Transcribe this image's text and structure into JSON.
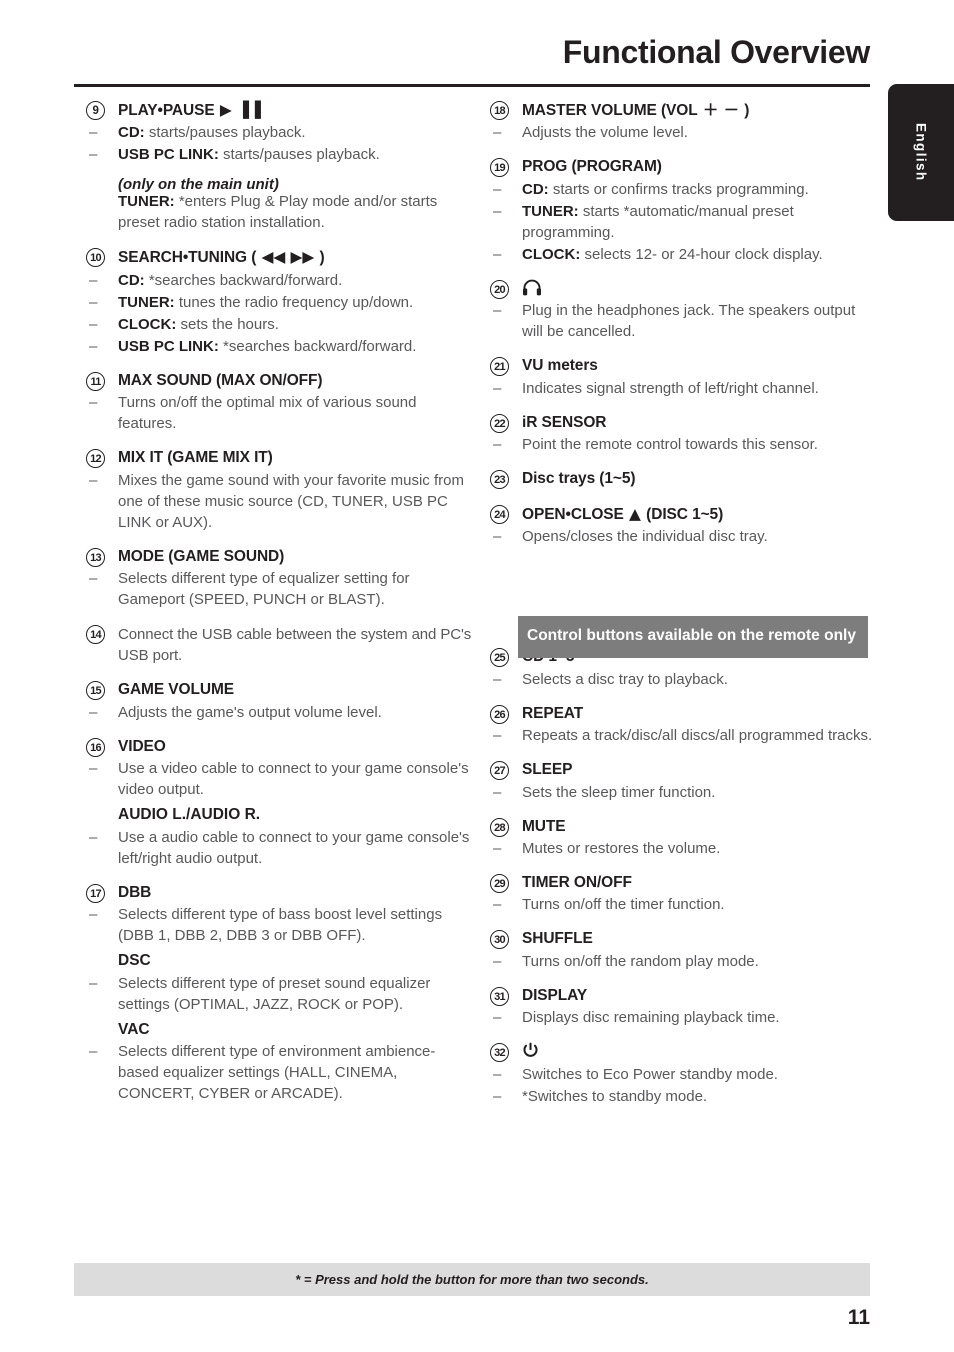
{
  "header": {
    "title": "Functional Overview"
  },
  "language_tab": {
    "label": "English"
  },
  "footer": {
    "note": "* = Press and hold the button for more than two seconds.",
    "page_number": "11"
  },
  "remote_banner": {
    "label": "Control buttons available on the remote only"
  },
  "glyphs": {
    "play": "▶",
    "pause": "▐▐",
    "rewind": "◀◀",
    "forward": "▶▶",
    "eject": "▲",
    "plus": "＋",
    "minus": "－",
    "headphones": "Ω",
    "power": "⏻",
    "dash": "–",
    "bullet_dot": "•"
  },
  "left_column": [
    {
      "number": "9",
      "title": "PLAY•PAUSE",
      "title_glyph": "▶ ▐▐",
      "bullets": [
        {
          "label": "CD:",
          "text": " starts/pauses playback."
        },
        {
          "label": "USB PC LINK:",
          "text": " starts/pauses playback."
        }
      ],
      "plain": [
        {
          "italic": "(only on the main unit)"
        },
        {
          "label": "TUNER:",
          "text": " *enters Plug & Play mode and/or starts preset radio station installation."
        }
      ]
    },
    {
      "number": "10",
      "title": "SEARCH•TUNING (",
      "title_glyph": "◀◀ ▶▶",
      "title_suffix": ")",
      "bullets": [
        {
          "label": "CD:",
          "text": " *searches backward/forward."
        },
        {
          "label": "TUNER:",
          "text": " tunes the radio frequency up/down."
        },
        {
          "label": "CLOCK:",
          "text": " sets the hours."
        },
        {
          "label": "USB PC LINK:",
          "text": " *searches backward/forward."
        }
      ]
    },
    {
      "number": "11",
      "title": "MAX SOUND (MAX ON/OFF)",
      "bullets": [
        {
          "label": "",
          "text": "Turns on/off the optimal mix of various sound features."
        }
      ]
    },
    {
      "number": "12",
      "title": "MIX IT (GAME MIX IT)",
      "bullets": [
        {
          "label": "",
          "text": "Mixes the game sound with your favorite music from one of these music source (CD, TUNER, USB PC LINK or AUX)."
        }
      ]
    },
    {
      "number": "13",
      "title": "MODE (GAME SOUND)",
      "bullets": [
        {
          "label": "",
          "text": "Selects different type of equalizer setting for Gameport (SPEED, PUNCH or BLAST)."
        }
      ]
    },
    {
      "number": "14",
      "title_regular": "Connect the USB cable between the system and PC's USB port.",
      "bullets": []
    },
    {
      "number": "15",
      "title": "GAME VOLUME",
      "bullets": [
        {
          "label": "",
          "text": "Adjusts the game's output volume level."
        }
      ]
    },
    {
      "number": "16",
      "title": "VIDEO",
      "bullets": [
        {
          "label": "",
          "text": "Use a video cable to connect to your game console's video output."
        }
      ],
      "subsections": [
        {
          "subhead": "AUDIO L./AUDIO R.",
          "bullets": [
            {
              "label": "",
              "text": "Use a audio cable to connect to your game console's left/right audio output."
            }
          ]
        }
      ]
    },
    {
      "number": "17",
      "title": "DBB",
      "bullets": [
        {
          "label": "",
          "text": "Selects different type of bass boost level settings (DBB 1, DBB 2, DBB 3 or DBB OFF)."
        }
      ],
      "subsections": [
        {
          "subhead": "DSC",
          "bullets": [
            {
              "label": "",
              "text": "Selects different type of preset sound equalizer settings (OPTIMAL, JAZZ, ROCK or POP)."
            }
          ]
        },
        {
          "subhead": "VAC",
          "bullets": [
            {
              "label": "",
              "text": "Selects different type of environment ambience-based equalizer settings (HALL, CINEMA, CONCERT, CYBER or ARCADE)."
            }
          ]
        }
      ]
    }
  ],
  "right_column_top": [
    {
      "number": "18",
      "title": "MASTER VOLUME (VOL",
      "title_glyph": "＋ －",
      "title_suffix": ")",
      "bullets": [
        {
          "label": "",
          "text": "Adjusts the volume level."
        }
      ]
    },
    {
      "number": "19",
      "title": "PROG (PROGRAM)",
      "bullets": [
        {
          "label": "CD:",
          "text": " starts or confirms tracks programming."
        },
        {
          "label": "TUNER:",
          "text": " starts *automatic/manual preset programming."
        },
        {
          "label": "CLOCK:",
          "text": " selects 12- or 24-hour clock display."
        }
      ]
    },
    {
      "number": "20",
      "title_icon": "headphones-icon",
      "bullets": [
        {
          "label": "",
          "text": "Plug in the headphones jack. The speakers output will be cancelled."
        }
      ]
    },
    {
      "number": "21",
      "title": "VU meters",
      "bullets": [
        {
          "label": "",
          "text": "Indicates signal strength of left/right channel."
        }
      ]
    },
    {
      "number": "22",
      "title": "iR SENSOR",
      "bullets": [
        {
          "label": "",
          "text": "Point the remote control towards this sensor."
        }
      ]
    },
    {
      "number": "23",
      "title": "Disc trays (1~5)",
      "bullets": []
    },
    {
      "number": "24",
      "title": "OPEN•CLOSE",
      "title_glyph": "▲",
      "title_suffix": "(DISC 1~5)",
      "bullets": [
        {
          "label": "",
          "text": "Opens/closes the individual disc tray."
        }
      ]
    }
  ],
  "right_column_bottom": [
    {
      "number": "25",
      "title": "CD 1~5",
      "bullets": [
        {
          "label": "",
          "text": "Selects a disc tray to playback."
        }
      ]
    },
    {
      "number": "26",
      "title": "REPEAT",
      "bullets": [
        {
          "label": "",
          "text": "Repeats a track/disc/all discs/all programmed tracks."
        }
      ]
    },
    {
      "number": "27",
      "title": "SLEEP",
      "bullets": [
        {
          "label": "",
          "text": "Sets the sleep timer function."
        }
      ]
    },
    {
      "number": "28",
      "title": "MUTE",
      "bullets": [
        {
          "label": "",
          "text": "Mutes or restores the volume."
        }
      ]
    },
    {
      "number": "29",
      "title": "TIMER ON/OFF",
      "bullets": [
        {
          "label": "",
          "text": "Turns on/off the timer function."
        }
      ]
    },
    {
      "number": "30",
      "title": "SHUFFLE",
      "bullets": [
        {
          "label": "",
          "text": "Turns on/off the random play mode."
        }
      ]
    },
    {
      "number": "31",
      "title": "DISPLAY",
      "bullets": [
        {
          "label": "",
          "text": "Displays disc remaining playback time."
        }
      ]
    },
    {
      "number": "32",
      "title_icon": "power-icon",
      "bullets": [
        {
          "label": "",
          "text": "Switches to Eco Power standby mode."
        },
        {
          "label": "",
          "text": "*Switches to standby mode."
        }
      ]
    }
  ]
}
